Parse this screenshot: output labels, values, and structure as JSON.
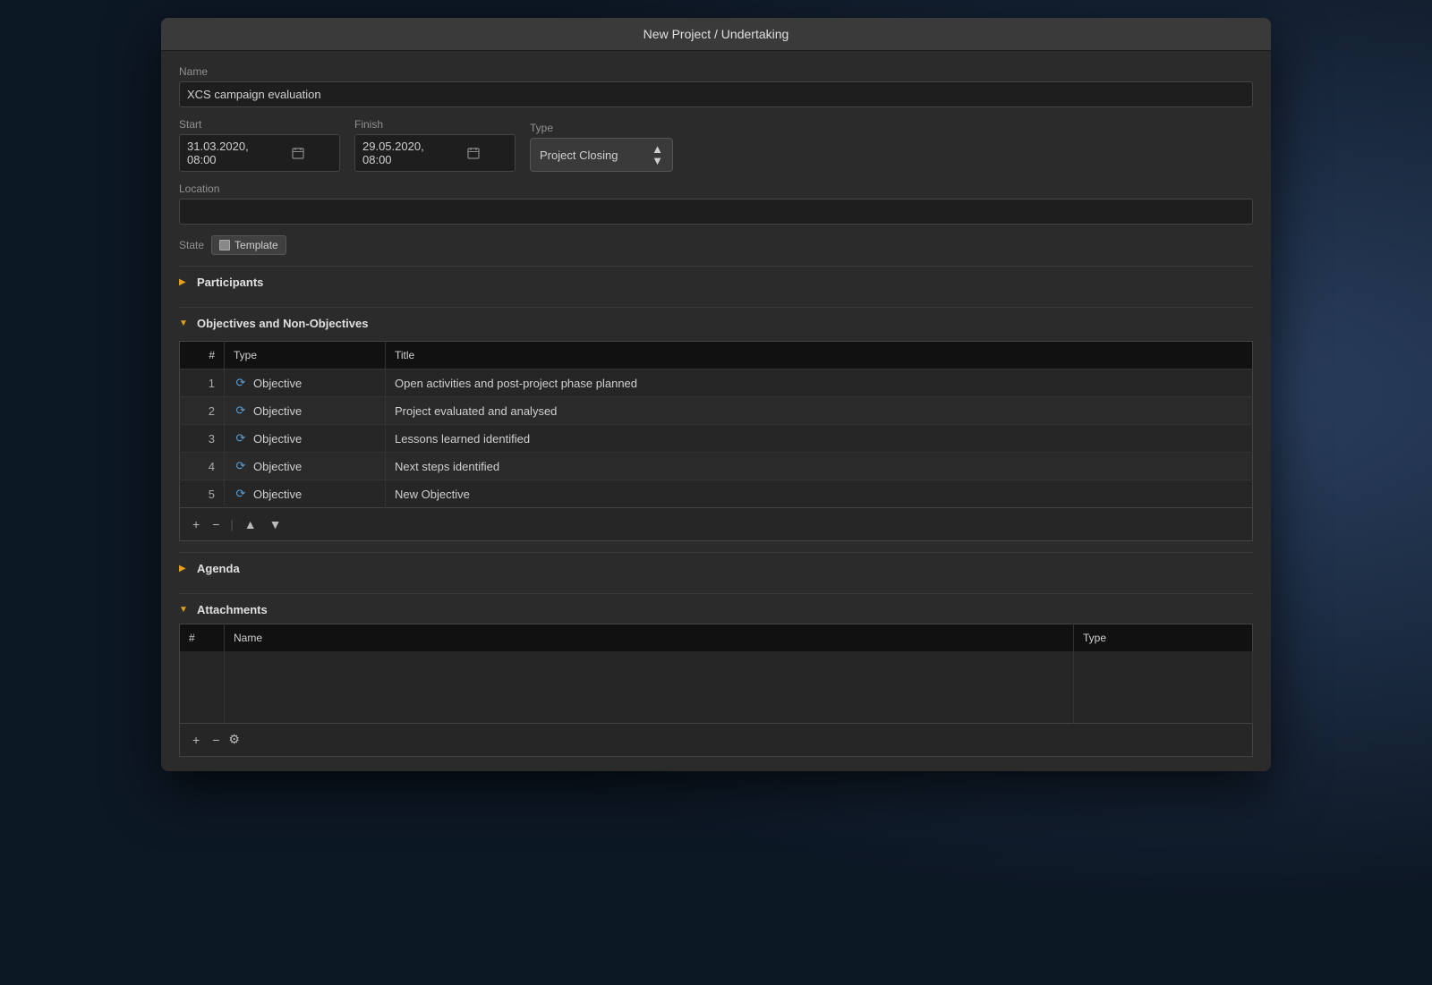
{
  "window": {
    "title": "New Project / Undertaking"
  },
  "form": {
    "name_label": "Name",
    "name_value": "XCS campaign evaluation",
    "start_label": "Start",
    "start_value": "31.03.2020, 08:00",
    "finish_label": "Finish",
    "finish_value": "29.05.2020, 08:00",
    "type_label": "Type",
    "type_value": "Project Closing",
    "location_label": "Location",
    "location_value": "",
    "state_label": "State",
    "state_value": "Template"
  },
  "sections": {
    "participants_label": "Participants",
    "objectives_label": "Objectives and Non-Objectives",
    "agenda_label": "Agenda",
    "attachments_label": "Attachments"
  },
  "objectives_table": {
    "col_num": "#",
    "col_type": "Type",
    "col_title": "Title",
    "rows": [
      {
        "num": "1",
        "type": "Objective",
        "title": "Open activities and post-project phase planned"
      },
      {
        "num": "2",
        "type": "Objective",
        "title": "Project evaluated and analysed"
      },
      {
        "num": "3",
        "type": "Objective",
        "title": "Lessons learned identified"
      },
      {
        "num": "4",
        "type": "Objective",
        "title": "Next steps identified"
      },
      {
        "num": "5",
        "type": "Objective",
        "title": "New Objective"
      }
    ]
  },
  "attachments_table": {
    "col_num": "#",
    "col_name": "Name",
    "col_type": "Type",
    "rows": []
  },
  "toolbar": {
    "add": "+",
    "remove": "−",
    "divider": "|",
    "up": "▲",
    "down": "▼"
  }
}
